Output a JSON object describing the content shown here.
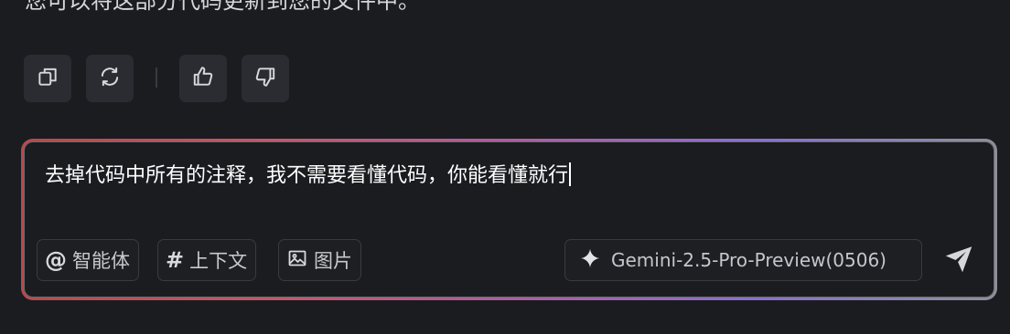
{
  "previous_message": {
    "text": "您可以将这部分代码更新到您的文件中。"
  },
  "actions": {
    "copy_icon": "copy-icon",
    "regenerate_icon": "refresh-icon",
    "like_icon": "thumbs-up-icon",
    "dislike_icon": "thumbs-down-icon"
  },
  "composer": {
    "input_text": "去掉代码中所有的注释，我不需要看懂代码，你能看懂就行",
    "chips": {
      "agent": {
        "glyph": "@",
        "label": "智能体"
      },
      "context": {
        "glyph": "#",
        "label": "上下文"
      },
      "image": {
        "icon": "image-icon",
        "label": "图片"
      }
    },
    "model": {
      "icon": "sparkle-icon",
      "label": "Gemini-2.5-Pro-Preview(0506)"
    },
    "send_icon": "send-icon"
  },
  "colors": {
    "background": "#1b1c1f",
    "button_bg": "#2b2c31",
    "gradient_start": "#b34a4f",
    "gradient_mid": "#a760a8",
    "gradient_end": "#8c8f99"
  }
}
